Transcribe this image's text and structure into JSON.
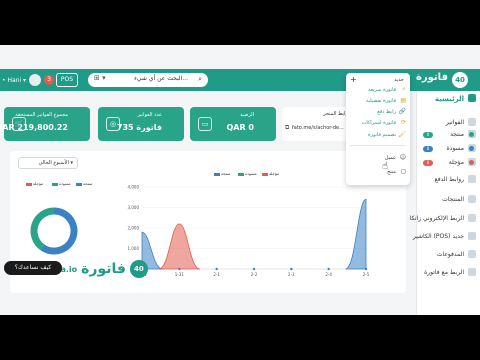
{
  "app": {
    "brand": "فاتورة",
    "logo_text": "40"
  },
  "topbar": {
    "search_placeholder": "البحث عن أي شيء...",
    "search_scope": "⊞ ▾",
    "pos_label": "POS",
    "user_name": "• Hani ▾",
    "notif_count": "3"
  },
  "sidebar": {
    "items": [
      {
        "label": "الرئيسية",
        "active": true
      },
      {
        "label": "الفواتير",
        "active": false
      },
      {
        "label": "منتجة",
        "active": false,
        "badge": "0",
        "dot": "#29a488"
      },
      {
        "label": "مسودة",
        "active": false,
        "badge": "0",
        "dot": "#3b82c4"
      },
      {
        "label": "مؤجلة",
        "active": false,
        "badge": "0",
        "dot": "#e25c4f"
      },
      {
        "label": "روابط الدفع",
        "active": false
      },
      {
        "label": "المنتجات",
        "active": false
      },
      {
        "label": "الربط الإلكتروني زاتكا",
        "active": false
      },
      {
        "label": "الكاشير (POS) جديد",
        "active": false
      },
      {
        "label": "المدفوعات",
        "active": false
      },
      {
        "label": "الربط مع فاتورة",
        "active": false
      }
    ]
  },
  "cards": [
    {
      "title": "الرصيد",
      "value": "QAR 0",
      "icon": "▭"
    },
    {
      "title": "عدد الفواتير",
      "value": "735 فاتورة",
      "icon": "◎"
    },
    {
      "title": "مجموع الفواتير المستحقة",
      "value": "QAR 219,800.22",
      "icon": "🛒"
    }
  ],
  "link_card": {
    "title": "رابط المتجر",
    "url": "fato.me/s/achor-de..."
  },
  "dropdown": {
    "header": "جديد",
    "items": [
      {
        "label": "فاتورة سريعة",
        "icon": "⚡"
      },
      {
        "label": "فاتورة تفصيلية",
        "icon": "▤"
      },
      {
        "label": "رابط دفع",
        "icon": "🔗"
      },
      {
        "label": "فاتورة اشتراكات",
        "icon": "⟳"
      },
      {
        "label": "تصميم فاتورة",
        "icon": "🖌"
      }
    ],
    "extra": [
      {
        "label": "عميل",
        "icon": "☺"
      },
      {
        "label": "منتج",
        "icon": "◻"
      }
    ]
  },
  "panel": {
    "period_label": "الأسبوع الحالي ▾",
    "donut_legend": [
      {
        "label": "منتجة",
        "color": "#3b82c4"
      },
      {
        "label": "مسودة",
        "color": "#29a488"
      },
      {
        "label": "مؤجلة",
        "color": "#e25c4f"
      }
    ],
    "line_legend": [
      {
        "label": "منتجة",
        "color": "#3b82c4"
      },
      {
        "label": "مسودة",
        "color": "#29a488"
      },
      {
        "label": "مؤجلة",
        "color": "#e25c4f"
      }
    ]
  },
  "chart_data": [
    {
      "type": "pie",
      "categories": [
        "منتجة",
        "مسودة",
        "مؤجلة"
      ],
      "values": [
        60,
        40,
        0
      ]
    },
    {
      "type": "area",
      "categories": [
        "1-30",
        "1-31",
        "2-1",
        "2-2",
        "2-3",
        "2-4",
        "2-5"
      ],
      "yticks": [
        "1,000",
        "2,000",
        "3,000",
        "4,000"
      ],
      "ylim": [
        0,
        4000
      ],
      "series": [
        {
          "name": "منتجة",
          "values": [
            1800,
            0,
            0,
            0,
            0,
            0,
            3400
          ]
        },
        {
          "name": "مسودة",
          "values": [
            0,
            0,
            0,
            0,
            0,
            0,
            0
          ]
        },
        {
          "name": "مؤجلة",
          "values": [
            0,
            2200,
            0,
            0,
            0,
            0,
            0
          ]
        }
      ]
    }
  ],
  "watermark": {
    "domain": "@ Fatora.io",
    "brand": "فاتورة",
    "logo": "40"
  },
  "help_button": "كيف نساعدك؟"
}
